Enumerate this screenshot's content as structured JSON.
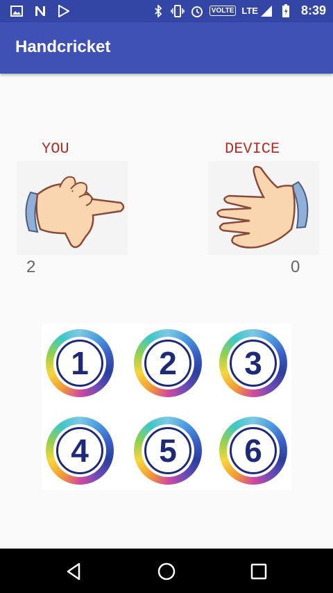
{
  "status_bar": {
    "time": "8:39",
    "lte_label": "LTE",
    "volte_label": "VOLTE",
    "left_icons": [
      "image-icon",
      "n-icon",
      "play-store-icon"
    ],
    "right_icons": [
      "bluetooth-icon",
      "vibrate-icon",
      "alarm-icon",
      "signal-icon",
      "battery-icon"
    ]
  },
  "app_bar": {
    "title": "Handcricket"
  },
  "players": {
    "you": {
      "label": "YOU",
      "score": "2"
    },
    "device": {
      "label": "DEVICE",
      "score": "0"
    }
  },
  "number_buttons": [
    "1",
    "2",
    "3",
    "4",
    "5",
    "6"
  ],
  "nav_bar": {
    "buttons": [
      "back-icon",
      "home-icon",
      "recents-icon"
    ]
  }
}
